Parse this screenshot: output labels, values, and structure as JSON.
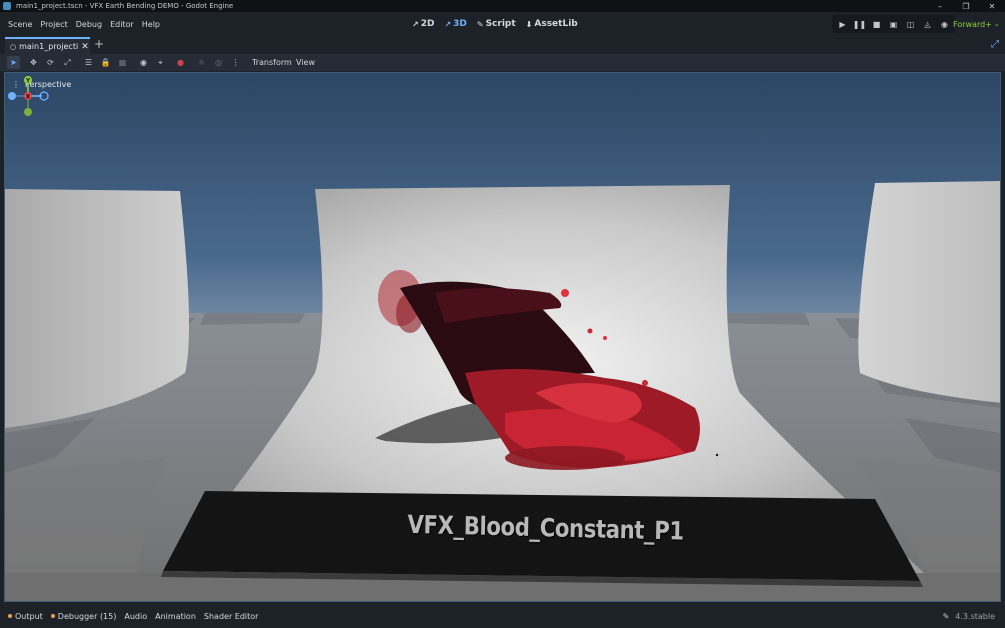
{
  "window": {
    "title": "main1_project.tscn - VFX Earth Bending DEMO - Godot Engine",
    "controls": [
      "minimize-icon",
      "restore-icon",
      "close-icon"
    ]
  },
  "menu": {
    "items": [
      "Scene",
      "Project",
      "Debug",
      "Editor",
      "Help"
    ]
  },
  "modes": [
    {
      "label": "2D",
      "icon": "2d-icon",
      "active": false
    },
    {
      "label": "3D",
      "icon": "3d-icon",
      "active": true
    },
    {
      "label": "Script",
      "icon": "script-icon",
      "active": false
    },
    {
      "label": "AssetLib",
      "icon": "assetlib-icon",
      "active": false
    }
  ],
  "renderer": {
    "label": "Forward+",
    "color": "#8ece3a"
  },
  "tabs": {
    "scene_tab": "main1_projecti",
    "add_icon": "plus-icon"
  },
  "toolbar": {
    "transform_label": "Transform",
    "view_label": "View"
  },
  "viewport": {
    "camera_label": "Perspective",
    "banner_text": "VFX_Blood_Constant_P1",
    "gizmo_axis_x": "X",
    "gizmo_axis_y": "Y"
  },
  "bottom_panel": {
    "output": "Output",
    "debugger": "Debugger (15)",
    "audio": "Audio",
    "animation": "Animation",
    "shader_editor": "Shader Editor",
    "version": "4.3.stable"
  },
  "colors": {
    "accent": "#6eb2ff",
    "error": "#ec8a85",
    "warning": "#e8a34b"
  }
}
